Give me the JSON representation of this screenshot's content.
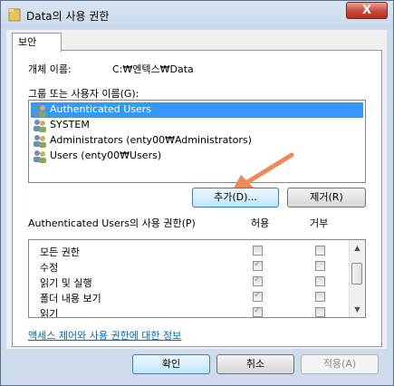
{
  "window": {
    "title": "Data의 사용 권한",
    "close_label": "X"
  },
  "tab": {
    "label": "보안"
  },
  "object": {
    "label": "개체 이름:",
    "value": "C:₩엔텍스₩Data"
  },
  "groups": {
    "label": "그룹 또는 사용자 이름(G):",
    "items": [
      {
        "label": "Authenticated Users",
        "selected": true
      },
      {
        "label": "SYSTEM",
        "selected": false
      },
      {
        "label": "Administrators (enty00₩Administrators)",
        "selected": false
      },
      {
        "label": "Users (enty00₩Users)",
        "selected": false
      }
    ]
  },
  "buttons": {
    "add": "추가(D)...",
    "remove": "제거(R)",
    "ok": "확인",
    "cancel": "취소",
    "apply": "적용(A)"
  },
  "permissions": {
    "header": "Authenticated Users의 사용 권한(P)",
    "allow_label": "허용",
    "deny_label": "거부",
    "rows": [
      {
        "name": "모든 권한",
        "allow": false,
        "deny": false
      },
      {
        "name": "수정",
        "allow": true,
        "deny": false
      },
      {
        "name": "읽기 및 실행",
        "allow": true,
        "deny": false
      },
      {
        "name": "폴더 내용 보기",
        "allow": true,
        "deny": false
      },
      {
        "name": "읽기",
        "allow": true,
        "deny": false
      }
    ]
  },
  "link": "액세스 제어와 사용 권한에 대한 정보",
  "colors": {
    "selection": "#3399ff",
    "annotation_arrow": "#f08a5a",
    "link": "#0066cc"
  }
}
